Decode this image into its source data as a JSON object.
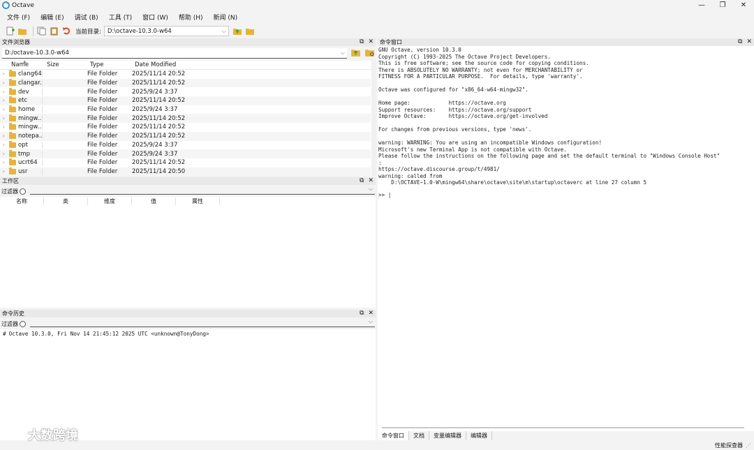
{
  "window": {
    "title": "Octave",
    "minimize": "—",
    "maximize": "❐",
    "close": "✕"
  },
  "menu": [
    "文件 (F)",
    "编辑 (E)",
    "调试 (B)",
    "工具 (T)",
    "窗口 (W)",
    "帮助 (H)",
    "新闻 (N)"
  ],
  "toolbar": {
    "current_dir_label": "当前目录:",
    "current_dir_value": "D:\\octave-10.3.0-w64"
  },
  "file_browser": {
    "title": "文件浏览器",
    "path": "D:/octave-10.3.0-w64",
    "columns": [
      "Name",
      "Size",
      "Type",
      "Date Modified"
    ],
    "rows": [
      {
        "name": "clang64",
        "type": "File Folder",
        "date": "2025/11/14 20:52"
      },
      {
        "name": "clangar...",
        "type": "File Folder",
        "date": "2025/11/14 20:52"
      },
      {
        "name": "dev",
        "type": "File Folder",
        "date": "2025/9/24 3:37"
      },
      {
        "name": "etc",
        "type": "File Folder",
        "date": "2025/11/14 20:52"
      },
      {
        "name": "home",
        "type": "File Folder",
        "date": "2025/9/24 3:37"
      },
      {
        "name": "mingw...",
        "type": "File Folder",
        "date": "2025/11/14 20:52"
      },
      {
        "name": "mingw...",
        "type": "File Folder",
        "date": "2025/11/14 20:52"
      },
      {
        "name": "notepa...",
        "type": "File Folder",
        "date": "2025/11/14 20:52"
      },
      {
        "name": "opt",
        "type": "File Folder",
        "date": "2025/9/24 3:37"
      },
      {
        "name": "tmp",
        "type": "File Folder",
        "date": "2025/9/24 3:37"
      },
      {
        "name": "ucrt64",
        "type": "File Folder",
        "date": "2025/11/14 20:52"
      },
      {
        "name": "usr",
        "type": "File Folder",
        "date": "2025/11/14 20:50"
      }
    ]
  },
  "workspace": {
    "title": "工作区",
    "filter_label": "过滤器",
    "columns": [
      "名称",
      "类",
      "维度",
      "值",
      "属性"
    ]
  },
  "history": {
    "title": "命令历史",
    "filter_label": "过滤器",
    "items": [
      "Octave 10.3.0, Fri Nov 14 21:45:12 2025 UTC <unknown@TonyDong>"
    ]
  },
  "command_window": {
    "title": "命令窗口",
    "output": "GNU Octave, version 10.3.0\nCopyright (C) 1993-2025 The Octave Project Developers.\nThis is free software; see the source code for copying conditions.\nThere is ABSOLUTELY NO WARRANTY; not even for MERCHANTABILITY or\nFITNESS FOR A PARTICULAR PURPOSE.  For details, type 'warranty'.\n\nOctave was configured for \"x86_64-w64-mingw32\".\n\nHome page:            https://octave.org\nSupport resources:    https://octave.org/support\nImprove Octave:       https://octave.org/get-involved\n\nFor changes from previous versions, type 'news'.\n\nwarning: WARNING: You are using an incompatible Windows configuration!\nMicrosoft's new Terminal App is not compatible with Octave.\nPlease follow the instructions on the following page and set the default terminal to \"Windows Console Host\"\n:\nhttps://octave.discourse.group/t/4981/\nwarning: called from\n    D:\\OCTAVE~1.0-W\\mingw64\\share\\octave\\site\\m\\startup\\octaverc at line 27 column 5",
    "prompt": ">> |"
  },
  "bottom_tabs": [
    "命令窗口",
    "文档",
    "变量编辑器",
    "编辑器"
  ],
  "status": {
    "text": "性能探查器",
    "grip": "⋰"
  },
  "watermark": {
    "text": "大数跨境"
  },
  "colors": {
    "folder": "#e8b33a",
    "accent_green": "#3aa33a",
    "undo_red": "#d84315"
  }
}
